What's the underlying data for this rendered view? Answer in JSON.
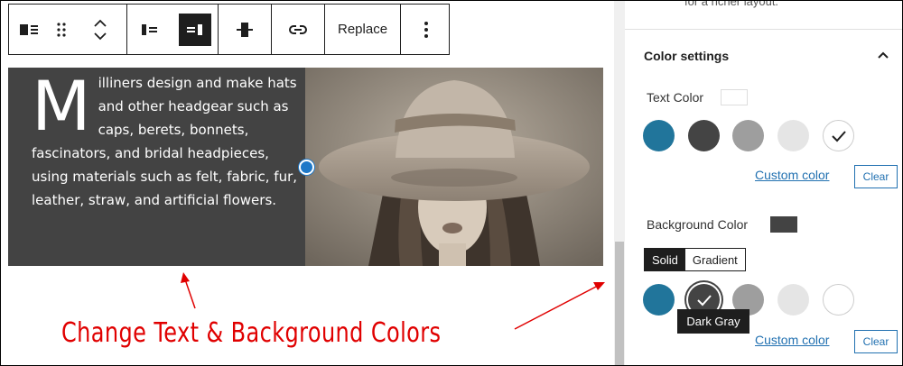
{
  "toolbar": {
    "replace_label": "Replace"
  },
  "block": {
    "dropcap": "M",
    "text": "illiners design and make hats and other headgear such as caps, berets, bonnets, fascinators, and bridal headpieces, using materials such as felt, fabric, fur, leather, straw, and artificial flowers."
  },
  "annotation": "Change Text & Background Colors",
  "sidebar": {
    "top_text": "for a richer layout.",
    "panel_title": "Color settings",
    "text_color_label": "Text Color",
    "background_color_label": "Background Color",
    "custom_color_label": "Custom color",
    "clear_label": "Clear",
    "solid_label": "Solid",
    "gradient_label": "Gradient",
    "tooltip": "Dark Gray"
  },
  "colors": {
    "block_bg": "#434343",
    "swatch_blue": "#21759b",
    "swatch_dark_gray": "#444444",
    "swatch_gray": "#9e9e9e",
    "swatch_light_gray": "#e5e5e5",
    "swatch_white": "#ffffff",
    "accent": "#2271b1",
    "annotation_red": "#e00000"
  }
}
